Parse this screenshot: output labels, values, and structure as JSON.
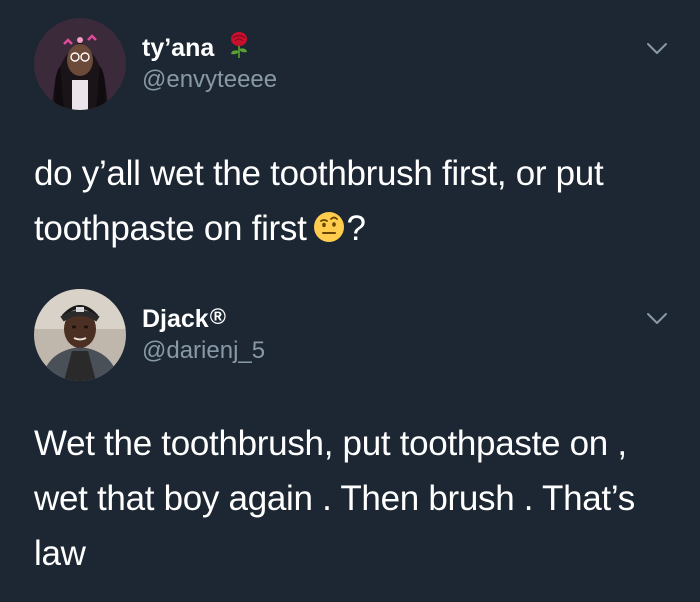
{
  "colors": {
    "background": "#1c2733",
    "text_primary": "#ffffff",
    "text_secondary": "#8899a6"
  },
  "tweets": [
    {
      "display_name": "ty’ana",
      "name_badge_icon": "rose-emoji-icon",
      "handle": "@envyteeee",
      "text_before_emoji": "do y’all wet the toothbrush first, or put toothpaste on first",
      "text_emoji_icon": "raised-eyebrow-face-emoji-icon",
      "text_after_emoji": "?"
    },
    {
      "display_name": "Djack",
      "name_suffix": "®",
      "handle": "@darienj_5",
      "text": "Wet the toothbrush, put toothpaste on , wet that boy again . Then brush . That’s law"
    }
  ]
}
